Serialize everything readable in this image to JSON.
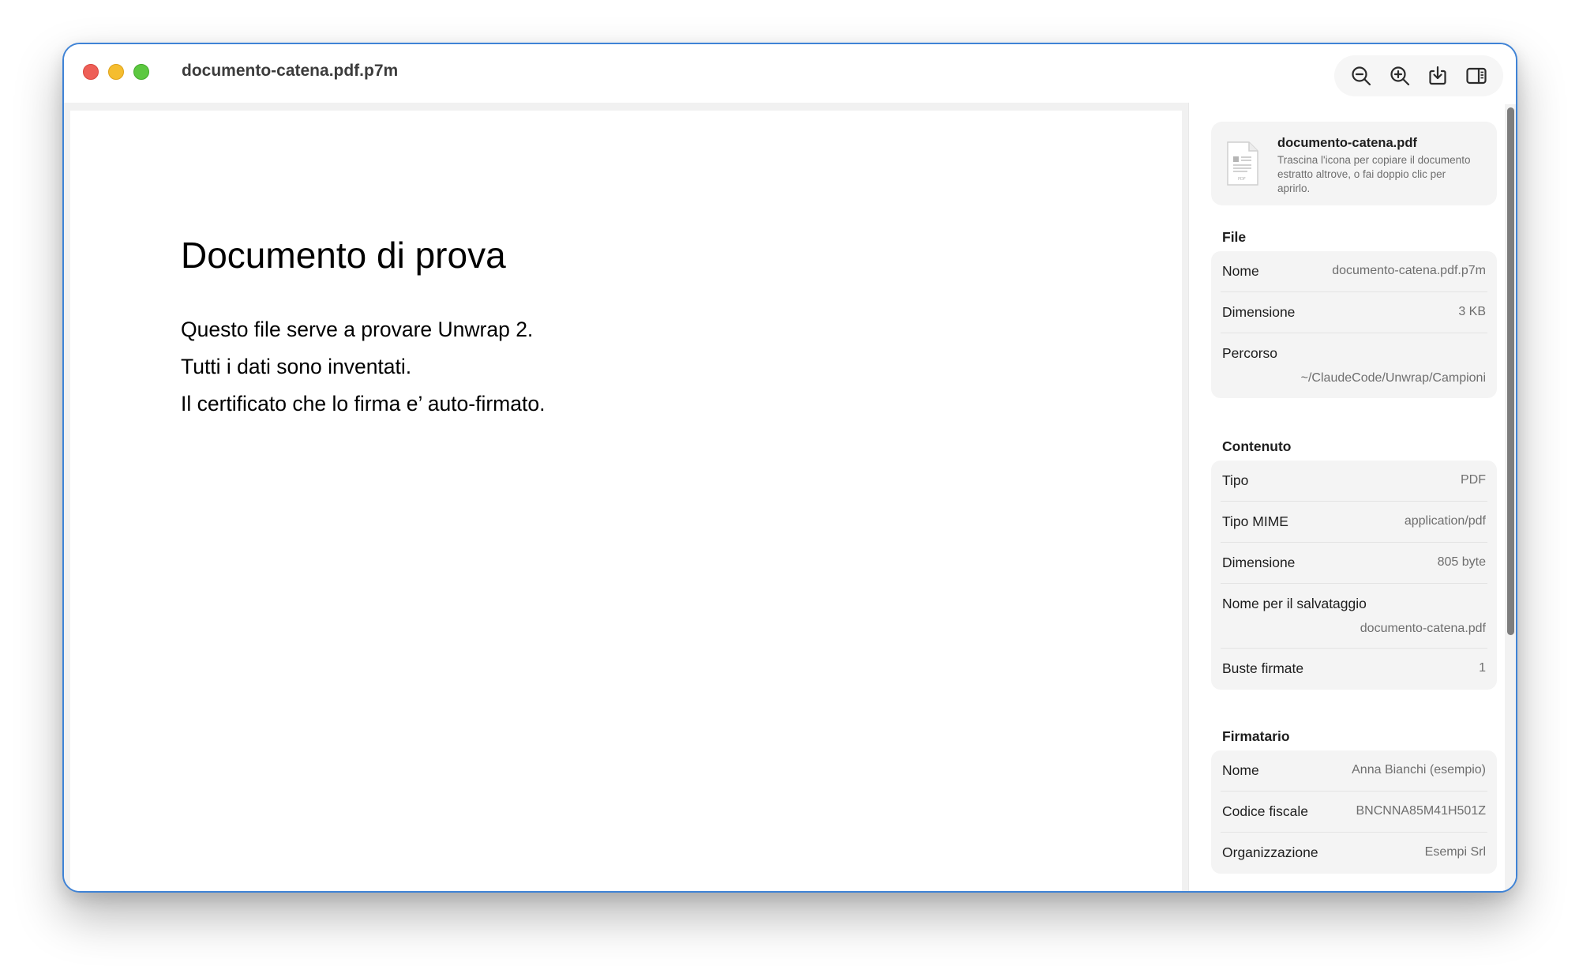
{
  "window": {
    "title": "documento-catena.pdf.p7m"
  },
  "toolbar": {
    "icons": [
      "zoom-out-icon",
      "zoom-in-icon",
      "save-icon",
      "sidebar-toggle-icon"
    ]
  },
  "document": {
    "heading": "Documento di prova",
    "lines": [
      "Questo file serve a provare Unwrap 2.",
      "Tutti i dati sono inventati.",
      "Il certificato che lo firma e’ auto-firmato."
    ]
  },
  "sidebar": {
    "file_card": {
      "name": "documento-catena.pdf",
      "hint": "Trascina l'icona per copiare il documento estratto altrove, o fai doppio clic per aprirlo.",
      "icon_text": "PDF"
    },
    "sections": {
      "file": {
        "title": "File",
        "rows": [
          {
            "label": "Nome",
            "value": "documento-catena.pdf.p7m"
          },
          {
            "label": "Dimensione",
            "value": "3 KB"
          },
          {
            "label": "Percorso",
            "value": "~/ClaudeCode/Unwrap/Campioni"
          }
        ]
      },
      "contenuto": {
        "title": "Contenuto",
        "rows": [
          {
            "label": "Tipo",
            "value": "PDF"
          },
          {
            "label": "Tipo MIME",
            "value": "application/pdf"
          },
          {
            "label": "Dimensione",
            "value": "805 byte"
          },
          {
            "label": "Nome per il salvataggio",
            "value": "documento-catena.pdf"
          },
          {
            "label": "Buste firmate",
            "value": "1"
          }
        ]
      },
      "firmatario": {
        "title": "Firmatario",
        "rows": [
          {
            "label": "Nome",
            "value": "Anna Bianchi (esempio)"
          },
          {
            "label": "Codice fiscale",
            "value": "BNCNNA85M41H501Z"
          },
          {
            "label": "Organizzazione",
            "value": "Esempi Srl"
          }
        ]
      }
    }
  }
}
